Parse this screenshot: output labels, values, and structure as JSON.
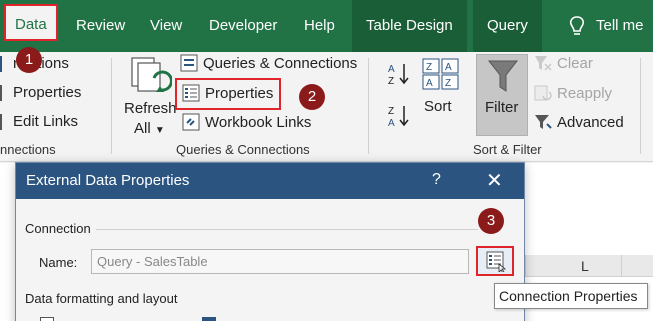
{
  "tabs": {
    "data": "Data",
    "review": "Review",
    "view": "View",
    "developer": "Developer",
    "help": "Help",
    "table_design": "Table Design",
    "query": "Query",
    "tell_me": "Tell me"
  },
  "ribbon": {
    "connections": "nections",
    "properties_left": "Properties",
    "edit_links": "Edit Links",
    "connections_group": "nnections",
    "refresh": "Refresh",
    "refresh_all": "All",
    "queries_connections": "Queries & Connections",
    "properties": "Properties",
    "workbook_links": "Workbook Links",
    "queries_group": "Queries & Connections",
    "clear": "Clear",
    "reapply": "Reapply",
    "sort": "Sort",
    "filter": "Filter",
    "advanced": "Advanced",
    "sort_filter_group": "Sort & Filter"
  },
  "badges": {
    "one": "1",
    "two": "2",
    "three": "3"
  },
  "sheet": {
    "col_l": "L"
  },
  "dialog": {
    "title": "External Data Properties",
    "help": "?",
    "close": "✕",
    "connection_section": "Connection",
    "name_label": "Name:",
    "name_value": "Query - SalesTable",
    "formatting_section": "Data formatting and layout"
  },
  "tooltip": "Connection Properties",
  "colors": {
    "excel_green": "#217346",
    "dialog_blue": "#2b5480",
    "highlight_red": "#e0242b",
    "badge_red": "#8b1a1a"
  }
}
